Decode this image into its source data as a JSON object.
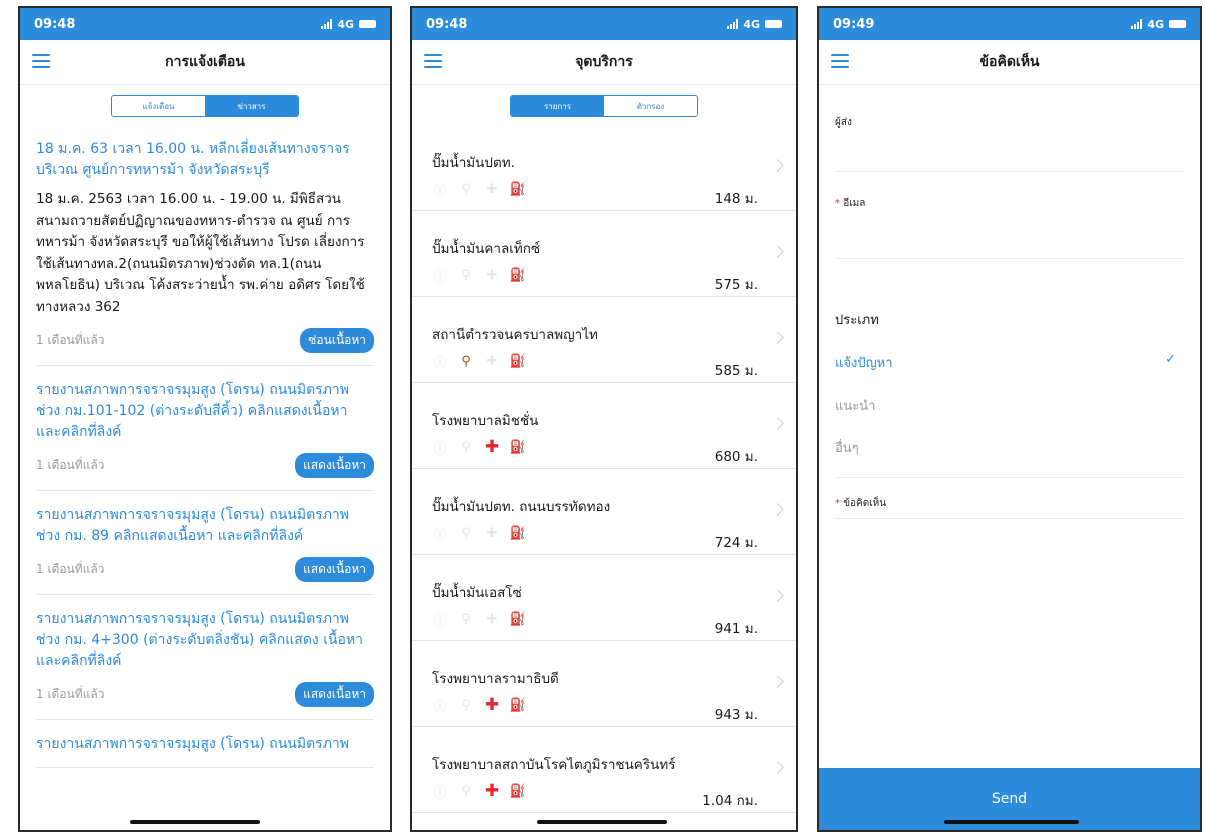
{
  "colors": {
    "accent": "#2d8bdc",
    "status_bar": "#2d8bdc",
    "hospital_cross": "#e0282e"
  },
  "phone1": {
    "status": {
      "time": "09:48",
      "network": "4G"
    },
    "title": "การแจ้งเตือน",
    "tabs": [
      "แจ้งเตือน",
      "ข่าวสาร"
    ],
    "notices": [
      {
        "title": "18 ม.ค. 63 เวลา 16.00 น. หลีกเลี่ยงเส้นทางจราจร บริเวณ ศูนย์การทหารม้า จังหวัดสระบุรี",
        "body": "18 ม.ค. 2563 เวลา 16.00 น. - 19.00 น. มีพิธีสวน สนามถวายสัตย์ปฏิญาณของทหาร-ตำรวจ ณ ศูนย์ การทหารม้า จังหวัดสระบุรี ขอให้ผู้ใช้เส้นทาง โปรด เลี่ยงการใช้เส้นทางทล.2(ถนนมิตรภาพ)ช่วงตัด ทล.1(ถนนพหลโยธิน) บริเวณ โค้งสระว่ายน้ำ รพ.ค่าย อดิศร โดยใช้ทางหลวง 362",
        "time": "1 เดือนที่แล้ว",
        "button": "ซ่อนเนื้อหา"
      },
      {
        "title": "รายงานสภาพการจราจรมุมสูง (โดรน) ถนนมิตรภาพ ช่วง กม.101-102 (ต่างระดับสีคิ้ว) คลิกแสดงเนื้อหา และคลิกที่ลิงค์",
        "body": "",
        "time": "1 เดือนที่แล้ว",
        "button": "แสดงเนื้อหา"
      },
      {
        "title": "รายงานสภาพการจราจรมุมสูง (โดรน) ถนนมิตรภาพ ช่วง กม. 89 คลิกแสดงเนื้อหา และคลิกที่ลิงค์",
        "body": "",
        "time": "1 เดือนที่แล้ว",
        "button": "แสดงเนื้อหา"
      },
      {
        "title": "รายงานสภาพการจราจรมุมสูง (โดรน) ถนนมิตรภาพ ช่วง กม. 4+300 (ต่างระดับตลิ่งชัน) คลิกแสดง เนื้อหา และคลิกที่ลิงค์",
        "body": "",
        "time": "1 เดือนที่แล้ว",
        "button": "แสดงเนื้อหา"
      },
      {
        "title": "รายงานสภาพการจราจรมุมสูง (โดรน) ถนนมิตรภาพ",
        "body": "",
        "time": "",
        "button": ""
      }
    ]
  },
  "phone2": {
    "status": {
      "time": "09:48",
      "network": "4G"
    },
    "title": "จุดบริการ",
    "tabs": [
      "รายการ",
      "ตัวกรอง"
    ],
    "places": [
      {
        "name": "ปั๊มน้ำมันปตท.",
        "distance": "148 ม.",
        "active_icon": "fuel"
      },
      {
        "name": "ปั๊มน้ำมันคาลเท็กซ์",
        "distance": "575 ม.",
        "active_icon": "fuel"
      },
      {
        "name": "สถานีตำรวจนครบาลพญาไท",
        "distance": "585 ม.",
        "active_icon": "police"
      },
      {
        "name": "โรงพยาบาลมิชชั่น",
        "distance": "680 ม.",
        "active_icon": "hospital"
      },
      {
        "name": "ปั๊มน้ำมันปตท. ถนนบรรทัดทอง",
        "distance": "724 ม.",
        "active_icon": "fuel"
      },
      {
        "name": "ปั๊มน้ำมันเอสโซ่",
        "distance": "941 ม.",
        "active_icon": "fuel"
      },
      {
        "name": "โรงพยาบาลรามาธิบดี",
        "distance": "943 ม.",
        "active_icon": "hospital"
      },
      {
        "name": "โรงพยาบาลสถาบันโรคไตภูมิราชนครินทร์",
        "distance": "1.04 กม.",
        "active_icon": "hospital"
      }
    ]
  },
  "phone3": {
    "status": {
      "time": "09:49",
      "network": "4G"
    },
    "title": "ข้อคิดเห็น",
    "sender_label": "ผู้ส่ง",
    "email_label": "อีเมล",
    "category_title": "ประเภท",
    "options": [
      "แจ้งปัญหา",
      "แนะนำ",
      "อื่นๆ"
    ],
    "selected_option": "แจ้งปัญหา",
    "comment_label": "ข้อคิดเห็น",
    "send": "Send"
  }
}
